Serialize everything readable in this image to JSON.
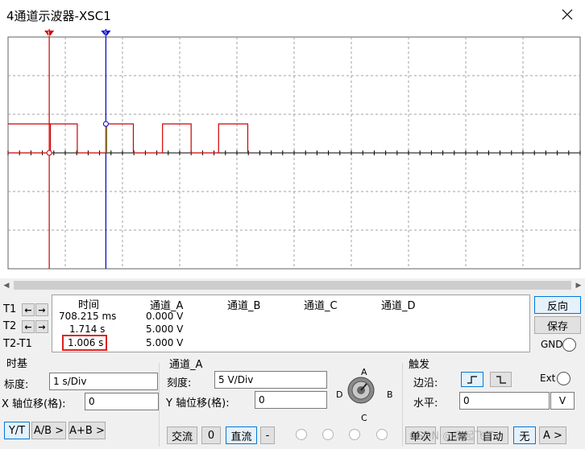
{
  "window": {
    "title": "4通道示波器-XSC1",
    "close_icon": "close-icon"
  },
  "scope": {
    "background": "#ffffff",
    "grid_color": "#a0a0a0",
    "trace_color": "#cc0000",
    "cursor1_color": "#cc0000",
    "cursor2_color": "#0000cc",
    "cursor1_label": "1",
    "cursor2_label": "2",
    "trace_levels": [
      "low",
      "high",
      "low",
      "high",
      "low",
      "high",
      "low",
      "high",
      "low",
      "high",
      "low"
    ]
  },
  "cursor_rows": {
    "t1": "T1",
    "t2": "T2",
    "t2t1": "T2-T1"
  },
  "measurements": {
    "headers": {
      "time": "时间",
      "ch_a": "通道_A",
      "ch_b": "通道_B",
      "ch_c": "通道_C",
      "ch_d": "通道_D"
    },
    "t1": {
      "time": "708.215 ms",
      "ch_a": "0.000 V"
    },
    "t2": {
      "time": "1.714 s",
      "ch_a": "5.000 V"
    },
    "t2t1": {
      "time": "1.006 s",
      "ch_a": "5.000 V"
    }
  },
  "right_buttons": {
    "reverse": "反向",
    "save": "保存",
    "gnd": "GND"
  },
  "timebase": {
    "title": "时基",
    "scale_label": "标度:",
    "scale_value": "1  s/Div",
    "xpos_label": "X 轴位移(格):",
    "xpos_value": "0",
    "modes": [
      "Y/T",
      "A/B >",
      "A+B >"
    ]
  },
  "channel": {
    "title": "通道_A",
    "scale_label": "刻度:",
    "scale_value": "5  V/Div",
    "ypos_label": "Y 轴位移(格):",
    "ypos_value": "0",
    "knob_labels": {
      "a": "A",
      "b": "B",
      "c": "C",
      "d": "D"
    },
    "coupling": {
      "ac": "交流",
      "zero": "0",
      "dc": "直流",
      "minus": "-"
    }
  },
  "trigger": {
    "title": "触发",
    "edge_label": "边沿:",
    "ext_label": "Ext",
    "level_label": "水平:",
    "level_value": "0",
    "level_unit": "V",
    "modes": [
      "单次",
      "正常",
      "自动",
      "无",
      "A >"
    ],
    "watermark": "CSDN @嗨起飞了"
  }
}
